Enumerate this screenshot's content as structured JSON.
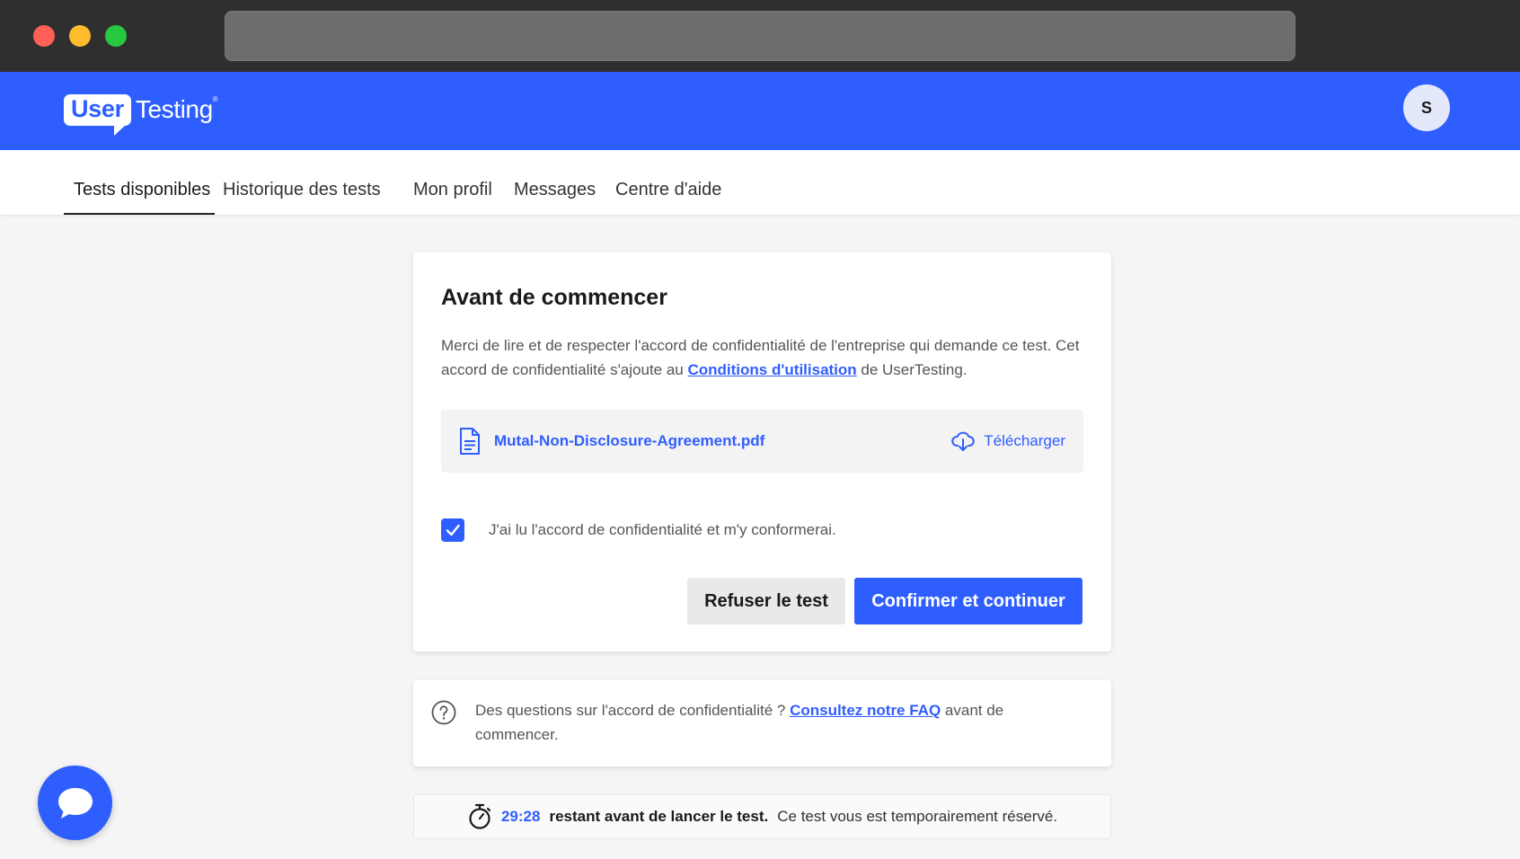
{
  "header": {
    "logo_user": "User",
    "logo_testing": "Testing",
    "logo_tm": "®",
    "avatar_initial": "S"
  },
  "nav": {
    "items": [
      {
        "label": "Tests disponibles",
        "active": true
      },
      {
        "label": "Historique des tests",
        "active": false
      },
      {
        "label": "Mon profil",
        "active": false
      },
      {
        "label": "Messages",
        "active": false
      },
      {
        "label": "Centre d'aide",
        "active": false
      }
    ]
  },
  "main": {
    "title": "Avant de commencer",
    "intro_before": "Merci de lire et de respecter l'accord de confidentialité de l'entreprise qui demande ce test. Cet accord de confidentialité s'ajoute au ",
    "intro_link": "Conditions d'utilisation",
    "intro_after": " de UserTesting.",
    "file_name": "Mutal-Non-Disclosure-Agreement.pdf",
    "download_label": "Télécharger",
    "checkbox_checked": true,
    "checkbox_label": "J'ai lu l'accord de confidentialité et m'y conformerai.",
    "refuse_label": "Refuser le test",
    "confirm_label": "Confirmer et continuer"
  },
  "faq": {
    "text_before": "Des questions sur l'accord de confidentialité ? ",
    "link": "Consultez notre FAQ",
    "text_after": " avant de commencer."
  },
  "timer": {
    "value": "29:28",
    "remaining": "restant avant de lancer le test.",
    "note": "Ce test vous est temporairement réservé."
  },
  "colors": {
    "brand_blue": "#2f5eff",
    "chrome_dark": "#2f2f2f",
    "page_bg": "#f5f5f5"
  }
}
